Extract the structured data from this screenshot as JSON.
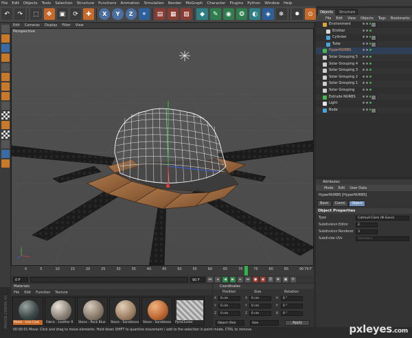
{
  "menubar": [
    "File",
    "Edit",
    "Objects",
    "Tools",
    "Selection",
    "Structure",
    "Functions",
    "Animation",
    "Simulation",
    "Render",
    "MoGraph",
    "Character",
    "Plugins",
    "Python",
    "Window",
    "Help"
  ],
  "toolbar": {
    "xyz": [
      "X",
      "Y",
      "Z"
    ]
  },
  "viewport": {
    "menu": [
      "Edit",
      "Cameras",
      "Display",
      "Filter",
      "View"
    ],
    "label": "Perspective"
  },
  "timeline": {
    "ticks": [
      "0",
      "5",
      "10",
      "15",
      "20",
      "25",
      "30",
      "35",
      "40",
      "45",
      "50",
      "55",
      "60",
      "65",
      "70",
      "75",
      "80",
      "85",
      "90"
    ],
    "current_frame": 72,
    "end_label": "79 F"
  },
  "playback": {
    "start": "0 F",
    "end": "90 F"
  },
  "materials": {
    "title": "Materials",
    "menu": [
      "File",
      "Edit",
      "Function",
      "Texture"
    ],
    "items": [
      {
        "label": "Metal - Iron Cast",
        "selected": true
      },
      {
        "label": "Fabric - Leather R",
        "selected": false
      },
      {
        "label": "Stone - Rock Blue",
        "selected": false
      },
      {
        "label": "Stone - Sandstone",
        "selected": false
      },
      {
        "label": "Stone - Sandstone",
        "selected": false
      },
      {
        "label": "PyroCluster",
        "selected": false
      }
    ]
  },
  "coordinates": {
    "title": "Coordinates",
    "headers": [
      "Position",
      "Size",
      "Rotation"
    ],
    "rows": [
      {
        "axis": "X",
        "pos": "0 cm",
        "size_axis": "X",
        "size": "0 cm",
        "rot_axis": "H",
        "rot": "0 °"
      },
      {
        "axis": "Y",
        "pos": "0 cm",
        "size_axis": "Y",
        "size": "0 cm",
        "rot_axis": "P",
        "rot": "0 °"
      },
      {
        "axis": "Z",
        "pos": "0 cm",
        "size_axis": "Z",
        "size": "0 cm",
        "rot_axis": "B",
        "rot": "0 °"
      }
    ],
    "mode": "Object (Rel)",
    "size_mode": "Size",
    "apply": "Apply"
  },
  "statusbar": "00:00:01  Move: Click and drag to move elements. Hold down SHIFT to quantize movement / add to the selection in point mode, CTRL to remove.",
  "objects_panel": {
    "tabs": [
      "Objects",
      "Structure"
    ],
    "menu": [
      "File",
      "Edit",
      "View",
      "Objects",
      "Tags",
      "Bookmarks"
    ],
    "items": [
      {
        "name": "Environment",
        "indent": 0,
        "selected": false,
        "icon": "#d9a441"
      },
      {
        "name": "Emitter",
        "indent": 1,
        "selected": false,
        "icon": "#d9d9d9"
      },
      {
        "name": "Cylinder",
        "indent": 1,
        "selected": false,
        "icon": "#4aa3d9"
      },
      {
        "name": "Tube",
        "indent": 1,
        "selected": false,
        "icon": "#4aa3d9"
      },
      {
        "name": "HyperNURBS",
        "indent": 0,
        "selected": true,
        "icon": "#4ab54f"
      },
      {
        "name": "Solar Grouping 5",
        "indent": 0,
        "selected": false,
        "icon": "#cfcfcf"
      },
      {
        "name": "Solar Grouping 4",
        "indent": 0,
        "selected": false,
        "icon": "#cfcfcf"
      },
      {
        "name": "Solar Grouping 3",
        "indent": 0,
        "selected": false,
        "icon": "#cfcfcf"
      },
      {
        "name": "Solar Grouping 2",
        "indent": 0,
        "selected": false,
        "icon": "#cfcfcf"
      },
      {
        "name": "Solar Grouping 1",
        "indent": 0,
        "selected": false,
        "icon": "#cfcfcf"
      },
      {
        "name": "Solar Grouping",
        "indent": 0,
        "selected": false,
        "icon": "#cfcfcf"
      },
      {
        "name": "Extrude NURBS",
        "indent": 0,
        "selected": false,
        "icon": "#4ab54f"
      },
      {
        "name": "Light",
        "indent": 0,
        "selected": false,
        "icon": "#e6e6e6"
      },
      {
        "name": "Bode",
        "indent": 0,
        "selected": false,
        "icon": "#4aa3d9"
      }
    ]
  },
  "attributes": {
    "title": "Attributes",
    "menu": [
      "Mode",
      "Edit",
      "User Data"
    ],
    "object": "HyperNURBS [HyperNURBS]",
    "buttons": [
      {
        "label": "Basic",
        "on": false
      },
      {
        "label": "Coord.",
        "on": false
      },
      {
        "label": "Object",
        "on": true
      }
    ],
    "section": "Object Properties",
    "props": [
      {
        "label": "Type",
        "value": "Catmull-Clark (N-Gons)",
        "dim": false
      },
      {
        "label": "Subdivision Editor",
        "value": "2",
        "dim": false
      },
      {
        "label": "Subdivision Renderer",
        "value": "3",
        "dim": false
      },
      {
        "label": "Subdivide UVs",
        "value": "Standard",
        "dim": true
      }
    ]
  },
  "watermark": {
    "main": "pxleyes",
    "suffix": ".com"
  },
  "side_logo": "MAXON CINEMA 4D"
}
